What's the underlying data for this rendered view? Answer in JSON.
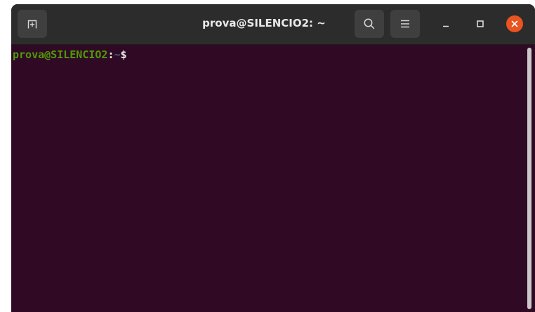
{
  "window": {
    "title": "prova@SILENCIO2: ~"
  },
  "header_buttons": {
    "new_tab_icon": "new-tab-icon",
    "search_icon": "search-icon",
    "menu_icon": "hamburger-menu-icon"
  },
  "window_controls": {
    "minimize_icon": "minimize-icon",
    "maximize_icon": "maximize-icon",
    "close_icon": "close-icon"
  },
  "terminal": {
    "prompt_user_host": "prova@SILENCIO2",
    "prompt_separator": ":",
    "prompt_path": "~",
    "prompt_symbol": "$"
  },
  "colors": {
    "terminal_background": "#300a24",
    "titlebar_background": "#2c2c2c",
    "prompt_user_host": "#4e9a06",
    "prompt_path": "#3465a4",
    "close_button": "#e95420"
  }
}
